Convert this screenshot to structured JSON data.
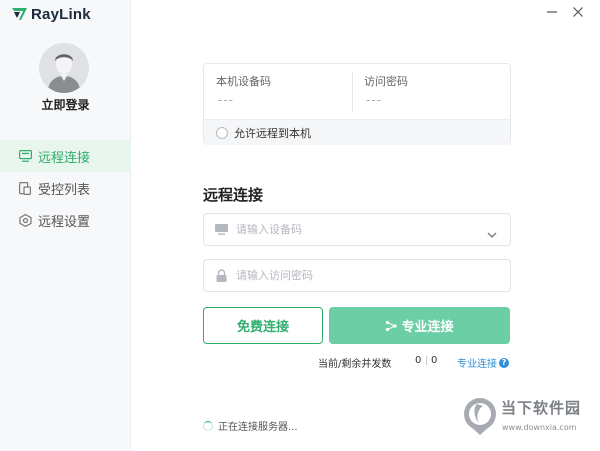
{
  "app": {
    "logo_text": "RayLink"
  },
  "sidebar": {
    "login_label": "立即登录",
    "items": [
      {
        "label": "远程连接",
        "icon": "monitor-icon",
        "active": true
      },
      {
        "label": "受控列表",
        "icon": "list-icon",
        "active": false
      },
      {
        "label": "远程设置",
        "icon": "settings-icon",
        "active": false
      }
    ]
  },
  "device_info": {
    "device_code_label": "本机设备码",
    "device_code_value": "---",
    "access_password_label": "访问密码",
    "access_password_value": "---",
    "allow_remote_label": "允许远程到本机"
  },
  "remote_connect": {
    "title": "远程连接",
    "device_code_placeholder": "请输入设备码",
    "access_password_placeholder": "请输入访问密码",
    "free_button_label": "免费连接",
    "pro_button_label": "专业连接",
    "concurrency_label": "当前/剩余并发数",
    "concurrency_current": "0",
    "concurrency_remaining": "0",
    "pro_link_label": "专业连接"
  },
  "status": {
    "text": "正在连接服务器..."
  },
  "watermark": {
    "main": "当下软件园",
    "sub": "www.downxia.com"
  },
  "colors": {
    "accent": "#2fae6e",
    "pro_button": "#6bcea4",
    "link": "#2f8fd8"
  }
}
